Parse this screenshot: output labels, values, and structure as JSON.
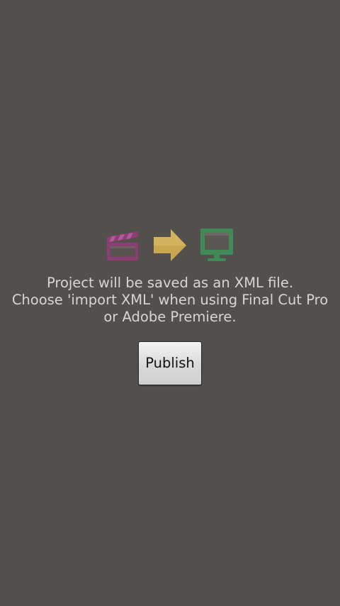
{
  "message": {
    "line1": "Project will be saved as an XML file.",
    "line2": "Choose 'import XML' when using Final Cut Pro",
    "line3": "or Adobe Premiere."
  },
  "publish_label": "Publish",
  "icons": [
    "clapperboard-icon",
    "arrow-right-icon",
    "monitor-icon"
  ],
  "colors": {
    "background": "#534f4c",
    "clapper": "#8c3e74",
    "arrow": "#c9a64f",
    "monitor": "#3f8a57",
    "text": "#d8d6d3"
  }
}
